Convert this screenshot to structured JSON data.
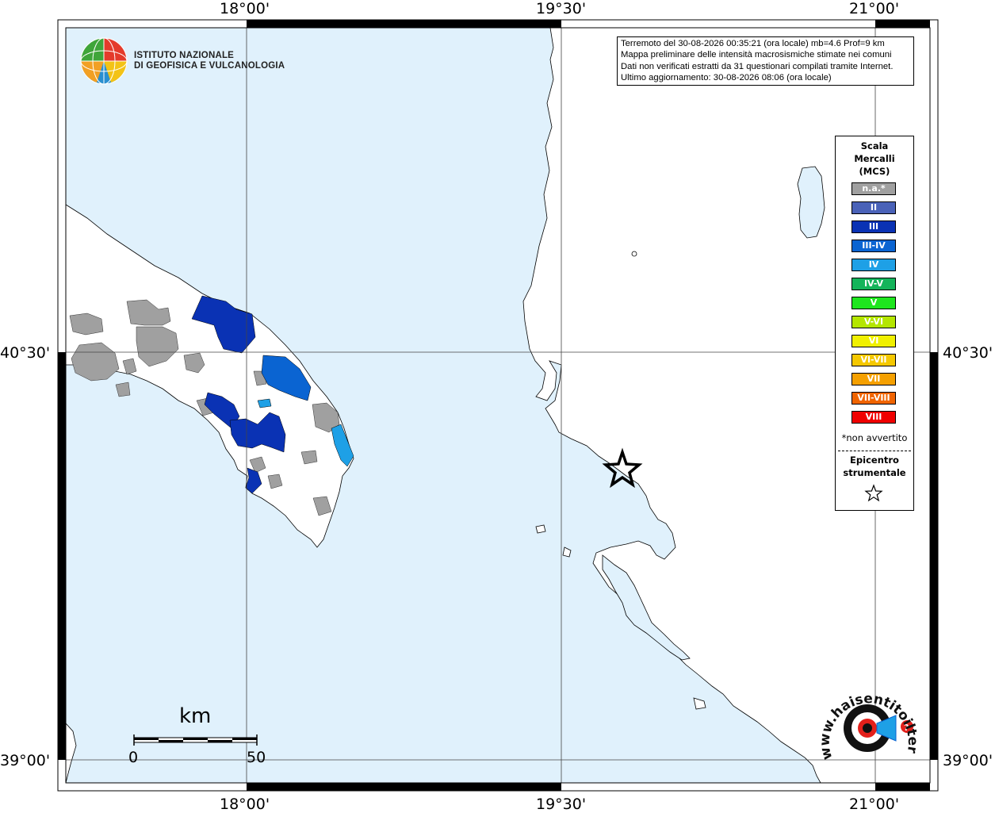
{
  "axes": {
    "top_labels": [
      "18°00'",
      "19°30'",
      "21°00'"
    ],
    "bottom_labels": [
      "18°00'",
      "19°30'",
      "21°00'"
    ],
    "left_labels": [
      "40°30'",
      "39°00'"
    ],
    "right_labels": [
      "40°30'",
      "39°00'"
    ]
  },
  "info": {
    "line1": "Terremoto del 30-08-2026 00:35:21 (ora locale) mb=4.6 Prof=9 km",
    "line2": "Mappa preliminare delle intensità macrosismiche stimate nei comuni",
    "line3": "Dati non verificati estratti da 31 questionari compilati tramite Internet.",
    "line4": "Ultimo aggiornamento: 30-08-2026 08:06 (ora locale)"
  },
  "logo": {
    "line1": "ISTITUTO NAZIONALE",
    "line2": "DI GEOFISICA E VULCANOLOGIA"
  },
  "legend": {
    "title_lines": [
      "Scala",
      "Mercalli",
      "(MCS)"
    ],
    "items": [
      {
        "label": "n.a.*",
        "color": "#a0a0a0"
      },
      {
        "label": "II",
        "color": "#4a62b8"
      },
      {
        "label": "III",
        "color": "#0a32b4"
      },
      {
        "label": "III-IV",
        "color": "#0a64d2"
      },
      {
        "label": "IV",
        "color": "#1ea0e6"
      },
      {
        "label": "IV-V",
        "color": "#14b45a"
      },
      {
        "label": "V",
        "color": "#1ee61e"
      },
      {
        "label": "V-VI",
        "color": "#b4e600"
      },
      {
        "label": "VI",
        "color": "#f0f000"
      },
      {
        "label": "VI-VII",
        "color": "#f5c800"
      },
      {
        "label": "VII",
        "color": "#f5a000"
      },
      {
        "label": "VII-VIII",
        "color": "#f06400"
      },
      {
        "label": "VIII",
        "color": "#f00000"
      }
    ],
    "note": "*non avvertito",
    "epicenter_lines": [
      "Epicentro",
      "strumentale"
    ]
  },
  "scale_bar": {
    "unit": "km",
    "tick_start": "0",
    "tick_end": "50"
  },
  "watermark": {
    "text_main": "www.haisentitoilterremoto.it"
  },
  "colors": {
    "sea": "#e0f1fc",
    "land": "#ffffff",
    "epicenter": "#000000"
  }
}
